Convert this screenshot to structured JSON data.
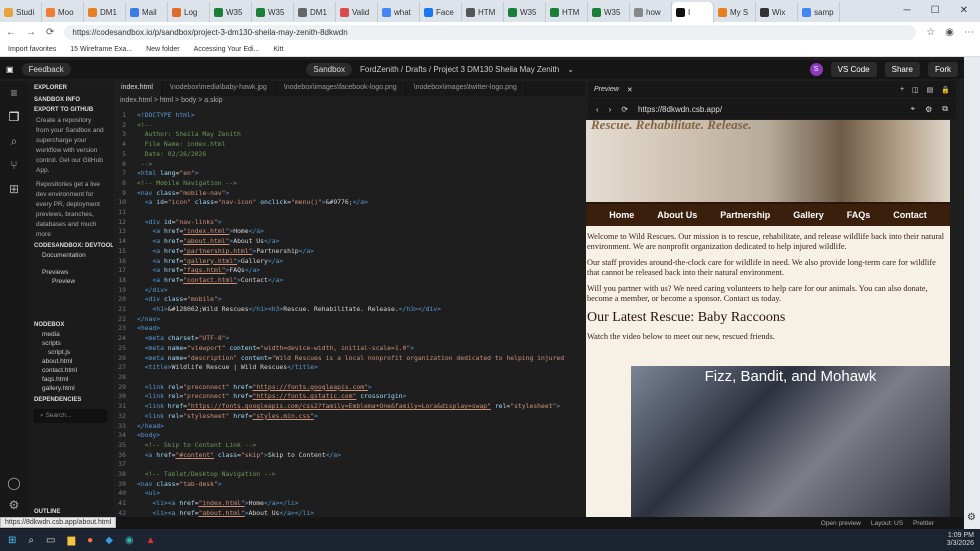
{
  "browser": {
    "tabs": [
      "Studi",
      "Moo",
      "DM1",
      "Mail",
      "Log",
      "W35",
      "W35",
      "DM1",
      "Valid",
      "what",
      "Face",
      "HTM",
      "W35",
      "HTM",
      "W35",
      "how",
      "I",
      "My S",
      "Wix",
      "samp"
    ],
    "url": "https://codesandbox.io/p/sandbox/project-3-dm130-sheila-may-zenith-8dkwdn",
    "bookmarks": [
      "Import favorites",
      "15 Wireframe Exa...",
      "New folder",
      "Accessing Your Edi...",
      "Kitt"
    ],
    "tab_colors": [
      "#e8a33d",
      "#f07c31",
      "#e67e22",
      "#3b7de8",
      "#e06b2b",
      "#188038",
      "#188038",
      "#666",
      "#d94c4c",
      "#4285f4",
      "#1877f2",
      "#555",
      "#188038",
      "#188038",
      "#188038",
      "#888",
      "#111",
      "#e67e22",
      "#333",
      "#4285f4"
    ]
  },
  "topbar": {
    "feedback": "Feedback",
    "sandbox": "Sandbox",
    "breadcrumb": "FordZenith / Drafts / Project 3 DM130 Sheila May Zenith",
    "avatar": "S",
    "vscode": "VS Code",
    "share": "Share",
    "fork": "Fork"
  },
  "sidebar": {
    "explorer": "EXPLORER",
    "sandbox_info": "SANDBOX INFO",
    "export": "EXPORT TO GITHUB",
    "export_text": "Create a repository from your Sandbox and supercharge your workflow with version control. Get our GitHub App.",
    "repo_text": "Repositories get a live dev environment for every PR, deployment previews, branches, databases and much more",
    "devtools": "CODESANDBOX: DEVTOOLS",
    "documentation": "Documentation",
    "previews": "Previews",
    "preview": "Preview",
    "nodebox": "NODEBOX",
    "files": [
      "media",
      "scripts",
      "script.js",
      "about.html",
      "contact.html",
      "faqs.html",
      "gallery.html"
    ],
    "dependencies": "DEPENDENCIES",
    "search": "Search...",
    "outline": "OUTLINE"
  },
  "editor": {
    "tabs": [
      "index.html",
      "\\nodebox\\media\\baby-hawk.jpg",
      "\\nodebox\\images\\facebook-logo.png",
      "\\nodebox\\images\\twitter-logo.png"
    ],
    "crumb": "index.html  >  html  >  body  >  a.skip",
    "lines": [
      {
        "n": "1",
        "t": [
          [
            "t-t",
            "<!DOCTYPE html>"
          ]
        ]
      },
      {
        "n": "2",
        "t": [
          [
            "t-c",
            "<!--"
          ]
        ]
      },
      {
        "n": "3",
        "t": [
          [
            "t-c",
            "  Author: Sheila May Zenith"
          ]
        ]
      },
      {
        "n": "4",
        "t": [
          [
            "t-c",
            "  File Name: index.html"
          ]
        ]
      },
      {
        "n": "5",
        "t": [
          [
            "t-c",
            "  Date: 02/26/2026"
          ]
        ]
      },
      {
        "n": "6",
        "t": [
          [
            "t-c",
            " -->"
          ]
        ]
      },
      {
        "n": "7",
        "t": [
          [
            "t-t",
            "<html "
          ],
          [
            "t-a",
            "lang"
          ],
          [
            "t-p",
            "="
          ],
          [
            "t-s",
            "\"en\""
          ],
          [
            "t-t",
            ">"
          ]
        ]
      },
      {
        "n": "8",
        "t": [
          [
            "t-c",
            "<!-- Mobile Navigation -->"
          ]
        ]
      },
      {
        "n": "9",
        "t": [
          [
            "t-t",
            "<nav "
          ],
          [
            "t-a",
            "class"
          ],
          [
            "t-p",
            "="
          ],
          [
            "t-s",
            "\"mobile-nav\""
          ],
          [
            "t-t",
            ">"
          ]
        ]
      },
      {
        "n": "10",
        "t": [
          [
            "t-t",
            "  <a "
          ],
          [
            "t-a",
            "id"
          ],
          [
            "t-p",
            "="
          ],
          [
            "t-s",
            "\"icon\" "
          ],
          [
            "t-a",
            "class"
          ],
          [
            "t-p",
            "="
          ],
          [
            "t-s",
            "\"nav-icon\" "
          ],
          [
            "t-a",
            "onclick"
          ],
          [
            "t-p",
            "="
          ],
          [
            "t-s",
            "\"menu()\""
          ],
          [
            "t-t",
            ">"
          ],
          [
            "t-p",
            "&#9776;"
          ],
          [
            "t-t",
            "</a>"
          ]
        ]
      },
      {
        "n": "11",
        "t": [
          [
            "t-p",
            ""
          ]
        ]
      },
      {
        "n": "12",
        "t": [
          [
            "t-t",
            "  <div "
          ],
          [
            "t-a",
            "id"
          ],
          [
            "t-p",
            "="
          ],
          [
            "t-s",
            "\"nav-links\""
          ],
          [
            "t-t",
            ">"
          ]
        ]
      },
      {
        "n": "13",
        "t": [
          [
            "t-t",
            "    <a "
          ],
          [
            "t-a",
            "href"
          ],
          [
            "t-p",
            "="
          ],
          [
            "t-u",
            "\"index.html\""
          ],
          [
            "t-t",
            ">"
          ],
          [
            "t-p",
            "Home"
          ],
          [
            "t-t",
            "</a>"
          ]
        ]
      },
      {
        "n": "14",
        "t": [
          [
            "t-t",
            "    <a "
          ],
          [
            "t-a",
            "href"
          ],
          [
            "t-p",
            "="
          ],
          [
            "t-u",
            "\"about.html\""
          ],
          [
            "t-t",
            ">"
          ],
          [
            "t-p",
            "About Us"
          ],
          [
            "t-t",
            "</a>"
          ]
        ]
      },
      {
        "n": "15",
        "t": [
          [
            "t-t",
            "    <a "
          ],
          [
            "t-a",
            "href"
          ],
          [
            "t-p",
            "="
          ],
          [
            "t-u",
            "\"partnership.html\""
          ],
          [
            "t-t",
            ">"
          ],
          [
            "t-p",
            "Partnership"
          ],
          [
            "t-t",
            "</a>"
          ]
        ]
      },
      {
        "n": "16",
        "t": [
          [
            "t-t",
            "    <a "
          ],
          [
            "t-a",
            "href"
          ],
          [
            "t-p",
            "="
          ],
          [
            "t-u",
            "\"gallery.html\""
          ],
          [
            "t-t",
            ">"
          ],
          [
            "t-p",
            "Gallery"
          ],
          [
            "t-t",
            "</a>"
          ]
        ]
      },
      {
        "n": "17",
        "t": [
          [
            "t-t",
            "    <a "
          ],
          [
            "t-a",
            "href"
          ],
          [
            "t-p",
            "="
          ],
          [
            "t-u",
            "\"faqs.html\""
          ],
          [
            "t-t",
            ">"
          ],
          [
            "t-p",
            "FAQs"
          ],
          [
            "t-t",
            "</a>"
          ]
        ]
      },
      {
        "n": "18",
        "t": [
          [
            "t-t",
            "    <a "
          ],
          [
            "t-a",
            "href"
          ],
          [
            "t-p",
            "="
          ],
          [
            "t-u",
            "\"contact.html\""
          ],
          [
            "t-t",
            ">"
          ],
          [
            "t-p",
            "Contact"
          ],
          [
            "t-t",
            "</a>"
          ]
        ]
      },
      {
        "n": "19",
        "t": [
          [
            "t-t",
            "  </div>"
          ]
        ]
      },
      {
        "n": "20",
        "t": [
          [
            "t-t",
            "  <div "
          ],
          [
            "t-a",
            "class"
          ],
          [
            "t-p",
            "="
          ],
          [
            "t-s",
            "\"mobile\""
          ],
          [
            "t-t",
            ">"
          ]
        ]
      },
      {
        "n": "21",
        "t": [
          [
            "t-t",
            "    <h1>"
          ],
          [
            "t-p",
            "&#128062;Wild Rescues"
          ],
          [
            "t-t",
            "</h1><h3>"
          ],
          [
            "t-p",
            "Rescue. Rehabilitate. Release."
          ],
          [
            "t-t",
            "</h3></div>"
          ]
        ]
      },
      {
        "n": "22",
        "t": [
          [
            "t-t",
            "</nav>"
          ]
        ]
      },
      {
        "n": "23",
        "t": [
          [
            "t-t",
            "<head>"
          ]
        ]
      },
      {
        "n": "24",
        "t": [
          [
            "t-t",
            "  <meta "
          ],
          [
            "t-a",
            "charset"
          ],
          [
            "t-p",
            "="
          ],
          [
            "t-s",
            "\"UTF-8\""
          ],
          [
            "t-t",
            ">"
          ]
        ]
      },
      {
        "n": "25",
        "t": [
          [
            "t-t",
            "  <meta "
          ],
          [
            "t-a",
            "name"
          ],
          [
            "t-p",
            "="
          ],
          [
            "t-s",
            "\"viewport\" "
          ],
          [
            "t-a",
            "content"
          ],
          [
            "t-p",
            "="
          ],
          [
            "t-s",
            "\"width=device-width, initial-scale=1.0\""
          ],
          [
            "t-t",
            ">"
          ]
        ]
      },
      {
        "n": "26",
        "t": [
          [
            "t-t",
            "  <meta "
          ],
          [
            "t-a",
            "name"
          ],
          [
            "t-p",
            "="
          ],
          [
            "t-s",
            "\"description\" "
          ],
          [
            "t-a",
            "content"
          ],
          [
            "t-p",
            "="
          ],
          [
            "t-s",
            "\"Wild Rescues is a local nonprofit organization dedicated to helping injured"
          ]
        ]
      },
      {
        "n": "27",
        "t": [
          [
            "t-t",
            "  <title>"
          ],
          [
            "t-p",
            "Wildlife Rescue | Wild Rescues"
          ],
          [
            "t-t",
            "</title>"
          ]
        ]
      },
      {
        "n": "28",
        "t": [
          [
            "t-p",
            ""
          ]
        ]
      },
      {
        "n": "29",
        "t": [
          [
            "t-t",
            "  <link "
          ],
          [
            "t-a",
            "rel"
          ],
          [
            "t-p",
            "="
          ],
          [
            "t-s",
            "\"preconnect\" "
          ],
          [
            "t-a",
            "href"
          ],
          [
            "t-p",
            "="
          ],
          [
            "t-u",
            "\"https://fonts.googleapis.com\""
          ],
          [
            "t-t",
            ">"
          ]
        ]
      },
      {
        "n": "30",
        "t": [
          [
            "t-t",
            "  <link "
          ],
          [
            "t-a",
            "rel"
          ],
          [
            "t-p",
            "="
          ],
          [
            "t-s",
            "\"preconnect\" "
          ],
          [
            "t-a",
            "href"
          ],
          [
            "t-p",
            "="
          ],
          [
            "t-u",
            "\"https://fonts.gstatic.com\""
          ],
          [
            "t-a",
            " crossorigin"
          ],
          [
            "t-t",
            ">"
          ]
        ]
      },
      {
        "n": "31",
        "t": [
          [
            "t-t",
            "  <link "
          ],
          [
            "t-a",
            "href"
          ],
          [
            "t-p",
            "="
          ],
          [
            "t-u",
            "\"https://fonts.googleapis.com/css2?family=Emblema+One&family=Lora&display=swap\""
          ],
          [
            "t-a",
            " rel"
          ],
          [
            "t-p",
            "="
          ],
          [
            "t-s",
            "\"stylesheet\""
          ],
          [
            "t-t",
            ">"
          ]
        ]
      },
      {
        "n": "32",
        "t": [
          [
            "t-t",
            "  <link "
          ],
          [
            "t-a",
            "rel"
          ],
          [
            "t-p",
            "="
          ],
          [
            "t-s",
            "\"stylesheet\" "
          ],
          [
            "t-a",
            "href"
          ],
          [
            "t-p",
            "="
          ],
          [
            "t-u",
            "\"styles.min.css\""
          ],
          [
            "t-t",
            ">"
          ]
        ]
      },
      {
        "n": "33",
        "t": [
          [
            "t-t",
            "</head>"
          ]
        ]
      },
      {
        "n": "34",
        "t": [
          [
            "t-t",
            "<body>"
          ]
        ]
      },
      {
        "n": "35",
        "t": [
          [
            "t-c",
            "  <!-- Skip to Content Link -->"
          ]
        ]
      },
      {
        "n": "36",
        "t": [
          [
            "t-t",
            "  <a "
          ],
          [
            "t-a",
            "href"
          ],
          [
            "t-p",
            "="
          ],
          [
            "t-u",
            "\"#content\""
          ],
          [
            "t-a",
            " class"
          ],
          [
            "t-p",
            "="
          ],
          [
            "t-s",
            "\"skip\""
          ],
          [
            "t-t",
            ">"
          ],
          [
            "t-p",
            "Skip to Content"
          ],
          [
            "t-t",
            "</a>"
          ]
        ]
      },
      {
        "n": "37",
        "t": [
          [
            "t-p",
            ""
          ]
        ]
      },
      {
        "n": "38",
        "t": [
          [
            "t-c",
            "  <!-- Tablet/Desktop Navigation -->"
          ]
        ]
      },
      {
        "n": "39",
        "t": [
          [
            "t-t",
            "<nav "
          ],
          [
            "t-a",
            "class"
          ],
          [
            "t-p",
            "="
          ],
          [
            "t-s",
            "\"tab-desk\""
          ],
          [
            "t-t",
            ">"
          ]
        ]
      },
      {
        "n": "40",
        "t": [
          [
            "t-t",
            "  <ul>"
          ]
        ]
      },
      {
        "n": "41",
        "t": [
          [
            "t-t",
            "    <li><a "
          ],
          [
            "t-a",
            "href"
          ],
          [
            "t-p",
            "="
          ],
          [
            "t-u",
            "\"index.html\""
          ],
          [
            "t-t",
            ">"
          ],
          [
            "t-p",
            "Home"
          ],
          [
            "t-t",
            "</a></li>"
          ]
        ]
      },
      {
        "n": "42",
        "t": [
          [
            "t-t",
            "    <li><a "
          ],
          [
            "t-a",
            "href"
          ],
          [
            "t-p",
            "="
          ],
          [
            "t-u",
            "\"about.html\""
          ],
          [
            "t-t",
            ">"
          ],
          [
            "t-p",
            "About Us"
          ],
          [
            "t-t",
            "</a></li>"
          ]
        ]
      }
    ]
  },
  "preview": {
    "title": "Preview",
    "url": "https://8dkwdn.csb.app/"
  },
  "site": {
    "tagline": "Rescue. Rehabilitate. Release.",
    "menu": [
      "Home",
      "About Us",
      "Partnership",
      "Gallery",
      "FAQs",
      "Contact"
    ],
    "p1": "Welcome to Wild Rescues. Our mission is to rescue, rehabilitate, and release wildlife back into their natural environment. We are nonprofit organization dedicated to help injured wildlife.",
    "p2": "Our staff provides around-the-clock care for wildlife in need. We also provide long-term care for wildlife that cannot be released back into their natural environment.",
    "p3": "Will you partner with us? We need caring volunteers to help care for our animals. You can also donate, become a member, or become a sponsor. Contact us today.",
    "h2": "Our Latest Rescue: Baby Raccoons",
    "p4": "Watch the video below to meet our new, rescued friends.",
    "video_title": "Fizz, Bandit, and Mohawk"
  },
  "status": {
    "hover_url": "https://8dkwdn.csb.app/about.html",
    "open_preview": "Open preview",
    "layout": "Layout: US",
    "prettier": "Prettier",
    "time": "1:09 PM",
    "date": "3/3/2026"
  }
}
